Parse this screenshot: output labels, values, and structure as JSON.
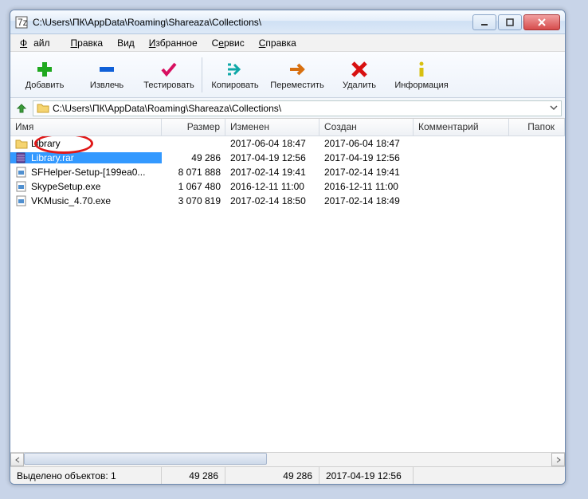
{
  "title": "C:\\Users\\ПК\\AppData\\Roaming\\Shareaza\\Collections\\",
  "menu": [
    "Файл",
    "Правка",
    "Вид",
    "Избранное",
    "Сервис",
    "Справка"
  ],
  "toolbar": [
    {
      "id": "add",
      "label": "Добавить"
    },
    {
      "id": "extract",
      "label": "Извлечь"
    },
    {
      "id": "test",
      "label": "Тестировать"
    },
    {
      "id": "copy",
      "label": "Копировать"
    },
    {
      "id": "move",
      "label": "Переместить"
    },
    {
      "id": "delete",
      "label": "Удалить"
    },
    {
      "id": "info",
      "label": "Информация"
    }
  ],
  "path": "C:\\Users\\ПК\\AppData\\Roaming\\Shareaza\\Collections\\",
  "columns": {
    "name": "Имя",
    "size": "Размер",
    "modified": "Изменен",
    "created": "Создан",
    "comment": "Комментарий",
    "folders": "Папок"
  },
  "rows": [
    {
      "icon": "folder",
      "name": "Library",
      "size": "",
      "modified": "2017-06-04 18:47",
      "created": "2017-06-04 18:47",
      "selected": false
    },
    {
      "icon": "rar",
      "name": "Library.rar",
      "size": "49 286",
      "modified": "2017-04-19 12:56",
      "created": "2017-04-19 12:56",
      "selected": true
    },
    {
      "icon": "exe",
      "name": "SFHelper-Setup-[199ea0...",
      "size": "8 071 888",
      "modified": "2017-02-14 19:41",
      "created": "2017-02-14 19:41",
      "selected": false
    },
    {
      "icon": "exe",
      "name": "SkypeSetup.exe",
      "size": "1 067 480",
      "modified": "2016-12-11 11:00",
      "created": "2016-12-11 11:00",
      "selected": false
    },
    {
      "icon": "exe",
      "name": "VKMusic_4.70.exe",
      "size": "3 070 819",
      "modified": "2017-02-14 18:50",
      "created": "2017-02-14 18:49",
      "selected": false
    }
  ],
  "status": {
    "sel_label": "Выделено объектов:",
    "sel_count": "1",
    "sel_size": "49 286",
    "sel_size2": "49 286",
    "sel_date": "2017-04-19 12:56"
  }
}
